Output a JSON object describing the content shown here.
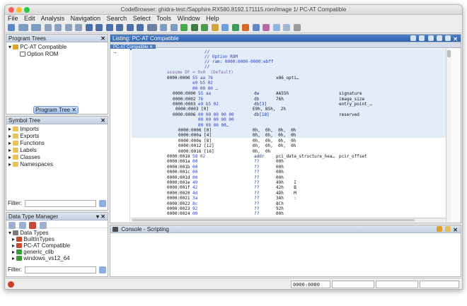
{
  "window": {
    "title": "CodeBrowser: ghidra-test:/Sapphire.RX580.8192.171115.rom/image 1/ PC-AT Compatible"
  },
  "menu": [
    "File",
    "Edit",
    "Analysis",
    "Navigation",
    "Search",
    "Select",
    "Tools",
    "Window",
    "Help"
  ],
  "program_trees": {
    "title": "Program Trees",
    "root": "PC-AT Compatible",
    "child": "Option ROM",
    "tab": "Program Tree"
  },
  "symbol_tree": {
    "title": "Symbol Tree",
    "items": [
      "Imports",
      "Exports",
      "Functions",
      "Labels",
      "Classes",
      "Namespaces"
    ],
    "filter_label": "Filter:"
  },
  "data_type_manager": {
    "title": "Data Type Manager",
    "root": "Data Types",
    "items": [
      "BuiltInTypes",
      "PC-AT Compatible",
      "generic_clib",
      "windows_vs12_64"
    ],
    "filter_label": "Filter:"
  },
  "listing": {
    "title": "Listing:  PC-AT Compatible",
    "tab": "PC-AT Compatible",
    "comments": [
      "//",
      "// Option ROM",
      "// ram: 0000:0000-0000:ebff",
      "//"
    ],
    "assume": "assume DF = 0x0  (Default)",
    "rows": [
      {
        "addr": "0000:0000",
        "bytes": "55 aa 76",
        "mnem": "",
        "ops": "x86_opti…",
        "name": ""
      },
      {
        "addr": "",
        "bytes": "e9 b5 02",
        "mnem": "",
        "ops": "",
        "name": ""
      },
      {
        "addr": "",
        "bytes": "00 00 00 …",
        "mnem": "",
        "ops": "",
        "name": ""
      },
      {
        "addr": "0000:0000",
        "bytes": "55 aa",
        "mnem": "dw",
        "ops": "AA55h",
        "name": "signature"
      },
      {
        "addr": "0000:0002",
        "bytes": "76",
        "mnem": "db",
        "ops": "76h",
        "name": "image_size"
      },
      {
        "addr": "0000:0003",
        "bytes": "e9 b5 02",
        "mnem": "db[3]",
        "ops": "",
        "name": "entry_point_…"
      },
      {
        "addr": "0000:0003 [0]",
        "bytes": "",
        "mnem": "",
        "ops": "E9h, B5h,  2h",
        "name": ""
      },
      {
        "addr": "0000:0006",
        "bytes": "00 00 00 00 00",
        "mnem": "db[18]",
        "ops": "",
        "name": "reserved"
      },
      {
        "addr": "",
        "bytes": "00 00 00 00 00",
        "mnem": "",
        "ops": "",
        "name": ""
      },
      {
        "addr": "",
        "bytes": "00 00 00 00…",
        "mnem": "",
        "ops": "",
        "name": ""
      },
      {
        "addr": "0000:0006 [0]",
        "bytes": "",
        "mnem": "",
        "ops": "0h,  0h,  0h,  0h",
        "name": ""
      },
      {
        "addr": "0000:000a [4]",
        "bytes": "",
        "mnem": "",
        "ops": "0h,  0h,  0h,  0h",
        "name": ""
      },
      {
        "addr": "0000:000e [8]",
        "bytes": "",
        "mnem": "",
        "ops": "0h,  0h,  0h,  0h",
        "name": ""
      },
      {
        "addr": "0000:0012 [12]",
        "bytes": "",
        "mnem": "",
        "ops": "0h,  0h,  0h,  0h",
        "name": ""
      },
      {
        "addr": "0000:0016 [16]",
        "bytes": "",
        "mnem": "",
        "ops": "0h,  0h",
        "name": ""
      },
      {
        "addr": "0000:0018",
        "bytes": "58 02",
        "mnem": "addr",
        "ops": "pci_data_structure_hea…",
        "name": "pcir_offset"
      },
      {
        "addr": "0000:001a",
        "bytes": "00",
        "mnem": "??",
        "ops": "00h",
        "name": ""
      },
      {
        "addr": "0000:001b",
        "bytes": "00",
        "mnem": "??",
        "ops": "00h",
        "name": ""
      },
      {
        "addr": "0000:001c",
        "bytes": "00",
        "mnem": "??",
        "ops": "00h",
        "name": ""
      },
      {
        "addr": "0000:001d",
        "bytes": "00",
        "mnem": "??",
        "ops": "00h",
        "name": ""
      },
      {
        "addr": "0000:001e",
        "bytes": "49",
        "mnem": "??",
        "ops": "49h    I",
        "name": ""
      },
      {
        "addr": "0000:001f",
        "bytes": "42",
        "mnem": "??",
        "ops": "42h    B",
        "name": ""
      },
      {
        "addr": "0000:0020",
        "bytes": "4d",
        "mnem": "??",
        "ops": "4Dh    M",
        "name": ""
      },
      {
        "addr": "0000:0021",
        "bytes": "3a",
        "mnem": "??",
        "ops": "3Ah    :",
        "name": ""
      },
      {
        "addr": "0000:0022",
        "bytes": "8c",
        "mnem": "??",
        "ops": "8Ch",
        "name": ""
      },
      {
        "addr": "0000:0023",
        "bytes": "92",
        "mnem": "??",
        "ops": "92h",
        "name": ""
      },
      {
        "addr": "0000:0024",
        "bytes": "00",
        "mnem": "??",
        "ops": "00h",
        "name": ""
      }
    ]
  },
  "console": {
    "title": "Console - Scripting"
  },
  "status": {
    "address": "0000:0000"
  },
  "colors": {
    "selection": "#e3ecf9",
    "header_selected": "#3a6db5",
    "address": "#111111",
    "bytes": "#2f43b5",
    "mnemonic": "#0a2fa8",
    "comment": "#2f43b5",
    "assume": "#7a6aa6"
  }
}
